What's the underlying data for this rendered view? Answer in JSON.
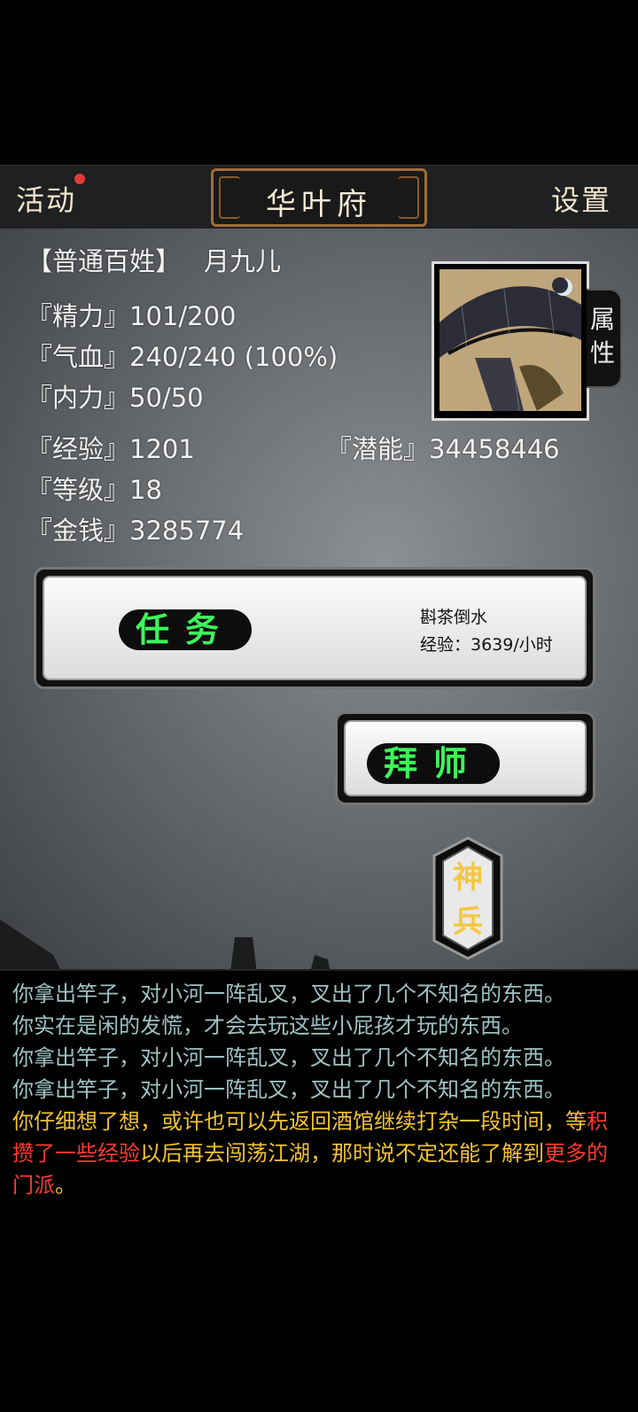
{
  "topbar": {
    "left_label": "活动",
    "title": "华叶府",
    "right_label": "设置"
  },
  "profile": {
    "rank": "【普通百姓】",
    "name": "月九儿",
    "stats": [
      {
        "label": "『精力』",
        "value": "101/200"
      },
      {
        "label": "『气血』",
        "value": "240/240 (100%)"
      },
      {
        "label": "『内力』",
        "value": "50/50"
      },
      {
        "label": "『经验』",
        "value": "1201"
      },
      {
        "label": "『等级』",
        "value": "18"
      },
      {
        "label": "『金钱』",
        "value": "3285774"
      }
    ],
    "potential": {
      "label": "『潜能』",
      "value": "34458446"
    },
    "attr_tab": [
      "属",
      "性"
    ]
  },
  "task": {
    "button_label": "任务",
    "name": "斟茶倒水",
    "exp_line": "经验：3639/小时"
  },
  "apprentice": {
    "button_label": "拜师"
  },
  "shenbing": {
    "chars": [
      "神",
      "兵"
    ]
  },
  "log": {
    "lines": [
      "你拿出竿子，对小河一阵乱叉，叉出了几个不知名的东西。",
      "你实在是闲的发慌，才会去玩这些小屁孩才玩的东西。",
      "你拿出竿子，对小河一阵乱叉，叉出了几个不知名的东西。",
      "你拿出竿子，对小河一阵乱叉，叉出了几个不知名的东西。"
    ],
    "hint": {
      "part1": "你仔细想了想，或许也可以先返回酒馆继续打杂一段时间，等",
      "highlight1": "积攒了一些经验",
      "part2": "以后再去闯荡江湖，那时说不定还能了解到",
      "highlight2": "更多的门派",
      "part3": "。"
    }
  },
  "colors": {
    "accent_green": "#3cf75a",
    "accent_gold": "#f3c744",
    "log_gray": "#9fc2c2",
    "log_yellow": "#f1c232",
    "log_red": "#ff3b30",
    "notify_dot": "#e23a3a"
  }
}
